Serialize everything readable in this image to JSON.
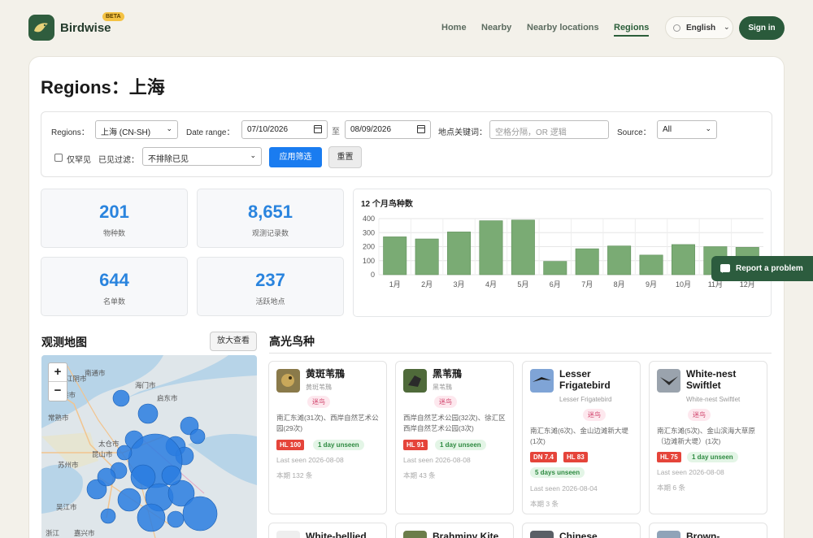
{
  "header": {
    "brand": "Birdwise",
    "beta": "BETA",
    "nav": [
      "Home",
      "Nearby",
      "Nearby locations",
      "Regions"
    ],
    "active_nav": "Regions",
    "language": "English",
    "signin": "Sign in"
  },
  "page": {
    "title": "Regions：上海"
  },
  "filters": {
    "region_label": "Regions：",
    "region_value": "上海 (CN-SH)",
    "date_label": "Date range：",
    "date_from": "07/10/2026",
    "date_sep": "至",
    "date_to": "08/09/2026",
    "keyword_label": "地点关键词：",
    "keyword_placeholder": "空格分隔，OR 逻辑",
    "source_label": "Source：",
    "source_value": "All",
    "rare_only": "仅罕见",
    "seen_filter_label": "已见过滤：",
    "seen_filter_value": "不排除已见",
    "apply": "应用筛选",
    "reset": "重置"
  },
  "stats": [
    {
      "value": "201",
      "label": "物种数"
    },
    {
      "value": "8,651",
      "label": "观测记录数"
    },
    {
      "value": "644",
      "label": "名单数"
    },
    {
      "value": "237",
      "label": "活跃地点"
    }
  ],
  "chart_data": {
    "type": "bar",
    "title": "12 个月鸟种数",
    "categories": [
      "1月",
      "2月",
      "3月",
      "4月",
      "5月",
      "6月",
      "7月",
      "8月",
      "9月",
      "10月",
      "11月",
      "12月"
    ],
    "values": [
      270,
      255,
      305,
      385,
      390,
      95,
      185,
      205,
      140,
      215,
      200,
      195
    ],
    "ylim": [
      0,
      400
    ],
    "yticks": [
      0,
      100,
      200,
      300,
      400
    ],
    "color": "#7aab74",
    "grid": true
  },
  "map": {
    "title": "观测地图",
    "zoom_button": "放大查看",
    "zoom_in": "+",
    "zoom_out": "−",
    "city_labels": [
      "南通市",
      "江阴市",
      "张家港市",
      "常熟市",
      "启东市",
      "太仓市",
      "昆山市",
      "苏州市",
      "吴江市",
      "嘉兴市",
      "海门市",
      "浙江"
    ]
  },
  "highlights": {
    "title": "高光鸟种",
    "cards": [
      {
        "name": "黄斑苇鳽",
        "sub": "黄斑苇鳽",
        "tag": "迷鸟",
        "locs": "南汇东滩(31次)、西岸自然艺术公园(29次)",
        "badges_red": [
          "HL 100"
        ],
        "badges_green": [
          "1 day unseen"
        ],
        "last": "Last seen 2026-08-08",
        "count": "本期 132 条"
      },
      {
        "name": "黑苇鳽",
        "sub": "黑苇鳽",
        "tag": "迷鸟",
        "locs": "西岸自然艺术公园(32次)、徐汇区西岸自然艺术公园(3次)",
        "badges_red": [
          "HL 91"
        ],
        "badges_green": [
          "1 day unseen"
        ],
        "last": "Last seen 2026-08-08",
        "count": "本期 43 条"
      },
      {
        "name": "Lesser Frigatebird",
        "sub": "Lesser Frigatebird",
        "tag": "迷鸟",
        "locs": "南汇东滩(6次)、金山边滩新大堤(1次)",
        "badges_red": [
          "DN 7.4",
          "HL 83"
        ],
        "badges_green": [
          "5 days unseen"
        ],
        "last": "Last seen 2026-08-04",
        "count": "本期 3 条"
      },
      {
        "name": "White-nest Swiftlet",
        "sub": "White-nest Swiftlet",
        "tag": "迷鸟",
        "locs": "南汇东滩(5次)、金山滨海大草原（边滩新大堤）(1次)",
        "badges_red": [
          "HL 75"
        ],
        "badges_green": [
          "1 day unseen"
        ],
        "last": "Last seen 2026-08-08",
        "count": "本期 6 条"
      }
    ],
    "next_row": [
      "White-bellied",
      "Brahminy Kite",
      "Chinese",
      "Brown-"
    ]
  },
  "report": {
    "label": "Report a problem"
  }
}
